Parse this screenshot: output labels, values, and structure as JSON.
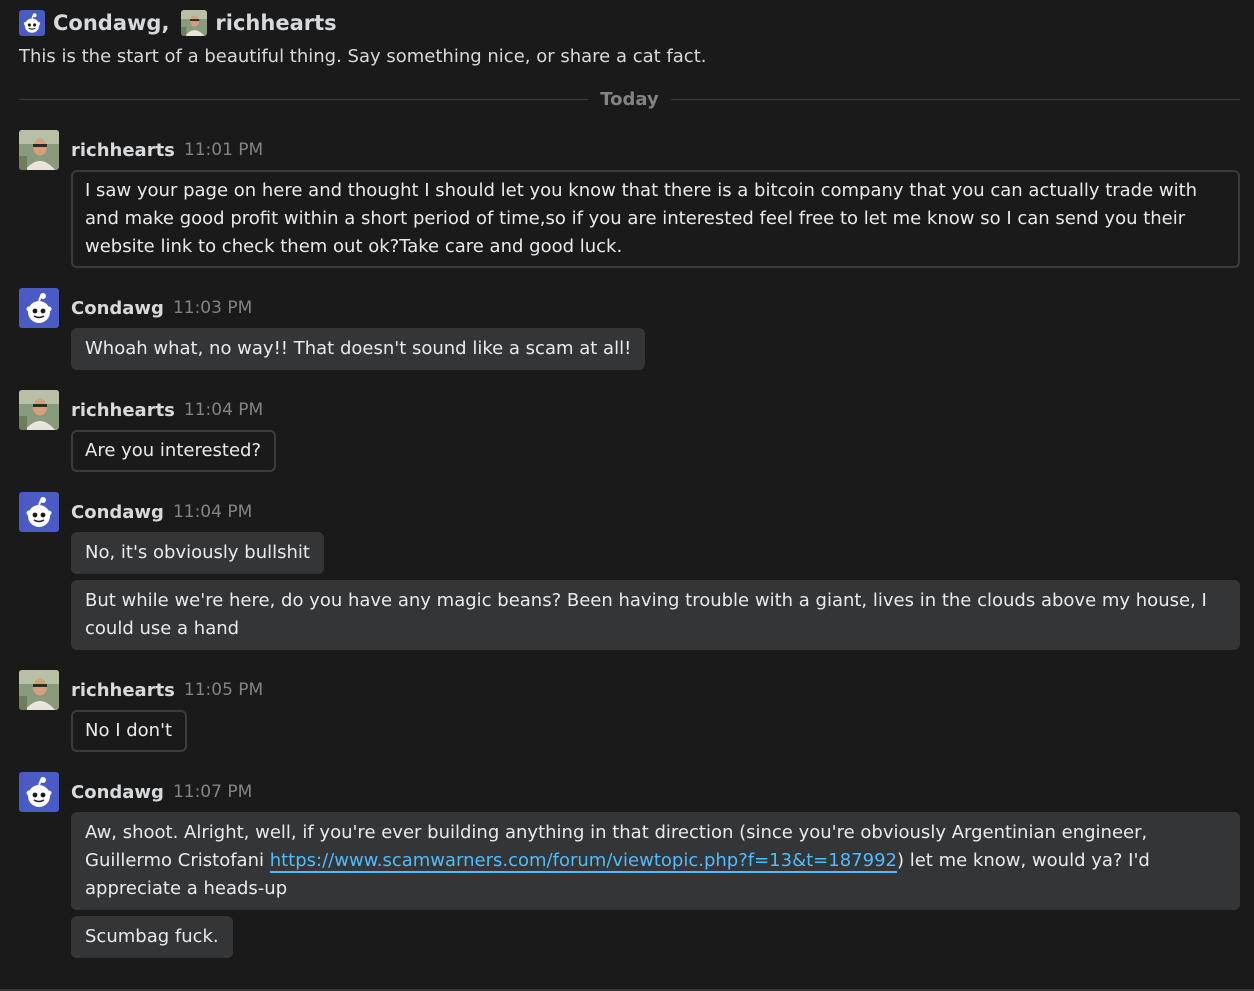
{
  "header": {
    "participant1": "Condawg",
    "separator": ",",
    "participant2": "richhearts"
  },
  "subtitle": "This is the start of a beautiful thing. Say something nice, or share a cat fact.",
  "divider_label": "Today",
  "messages": [
    {
      "author": "richhearts",
      "time": "11:01 PM",
      "bubbles": [
        "I saw your page on here and thought I should let you know that there is a bitcoin company that you can actually trade with and make good profit within a short period of time,so if you are interested feel free to let me know so I can send you their website link to check them out ok?Take care and good luck."
      ]
    },
    {
      "author": "Condawg",
      "time": "11:03 PM",
      "bubbles": [
        "Whoah what, no way!! That doesn't sound like a scam at all!"
      ]
    },
    {
      "author": "richhearts",
      "time": "11:04 PM",
      "bubbles": [
        "Are you interested?"
      ]
    },
    {
      "author": "Condawg",
      "time": "11:04 PM",
      "bubbles": [
        "No, it's obviously bullshit",
        "But while we're here, do you have any magic beans? Been having trouble with a giant, lives in the clouds above my house, I could use a hand"
      ]
    },
    {
      "author": "richhearts",
      "time": "11:05 PM",
      "bubbles": [
        "No I don't"
      ]
    },
    {
      "author": "Condawg",
      "time": "11:07 PM",
      "bubbles": [
        {
          "before": "Aw, shoot. Alright, well, if you're ever building anything in that direction (since you're obviously Argentinian engineer, Guillermo Cristofani ",
          "link": "https://www.scamwarners.com/forum/viewtopic.php?f=13&t=187992",
          "after": ") let me know, would ya? I'd appreciate a heads-up"
        },
        "Scumbag fuck."
      ]
    }
  ],
  "colors": {
    "background": "#1a1a1b",
    "bubble_outgoing": "#343536",
    "bubble_incoming_border": "#3a3b3c",
    "link": "#4fbcff",
    "muted": "#818384",
    "avatar_bot_bg": "#4a5bc4"
  },
  "icons": {
    "condawg_avatar": "reddit-snoo-avatar-icon",
    "richhearts_avatar": "user-photo-avatar"
  }
}
